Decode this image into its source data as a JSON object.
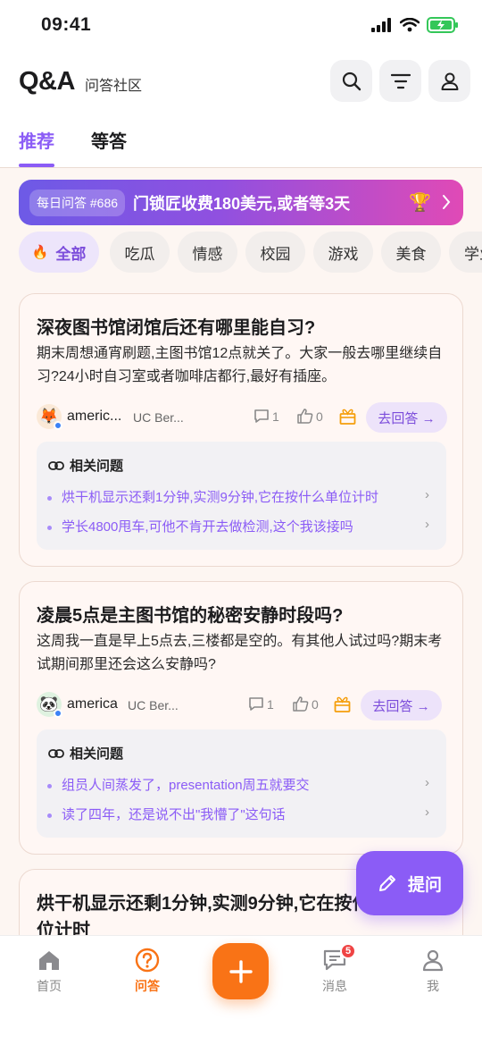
{
  "status": {
    "time": "09:41"
  },
  "header": {
    "logo": "Q&A",
    "subtitle": "问答社区",
    "tabs": [
      {
        "label": "推荐"
      },
      {
        "label": "等答"
      }
    ]
  },
  "daily": {
    "badge": "每日问答 #686",
    "text": "门锁匠收费180美元,或者等3天",
    "trophy": "🏆"
  },
  "chips": [
    {
      "label": "全部",
      "icon": "🔥"
    },
    {
      "label": "吃瓜"
    },
    {
      "label": "情感"
    },
    {
      "label": "校园"
    },
    {
      "label": "游戏"
    },
    {
      "label": "美食"
    },
    {
      "label": "学业"
    }
  ],
  "cards": [
    {
      "title": "深夜图书馆闭馆后还有哪里能自习?",
      "body": "期末周想通宵刷题,主图书馆12点就关了。大家一般去哪里继续自习?24小时自习室或者咖啡店都行,最好有插座。",
      "avatar": "🦊",
      "author": "americ...",
      "school": "UC Ber...",
      "comments": "1",
      "likes": "0",
      "answer_label": "去回答 →",
      "related_title": "相关问题",
      "related": [
        "烘干机显示还剩1分钟,实测9分钟,它在按什么单位计时",
        "学长4800甩车,可他不肯开去做检测,这个我该接吗"
      ]
    },
    {
      "title": "凌晨5点是主图书馆的秘密安静时段吗?",
      "body": "这周我一直是早上5点去,三楼都是空的。有其他人试过吗?期末考试期间那里还会这么安静吗?",
      "avatar": "🐼",
      "author": "america",
      "school": "UC Ber...",
      "comments": "1",
      "likes": "0",
      "answer_label": "去回答 →",
      "related_title": "相关问题",
      "related": [
        "组员人间蒸发了，presentation周五就要交",
        "读了四年，还是说不出\"我懵了\"这句话"
      ]
    },
    {
      "title": "烘干机显示还剩1分钟,实测9分钟,它在按什么单",
      "title2": "位计时"
    }
  ],
  "fab": {
    "label": "提问"
  },
  "nav": {
    "items": [
      {
        "label": "首页"
      },
      {
        "label": "问答"
      },
      {
        "label": "消息",
        "badge": "5"
      },
      {
        "label": "我"
      }
    ]
  },
  "colors": {
    "accent": "#8b5cf6",
    "orange": "#f97316"
  }
}
